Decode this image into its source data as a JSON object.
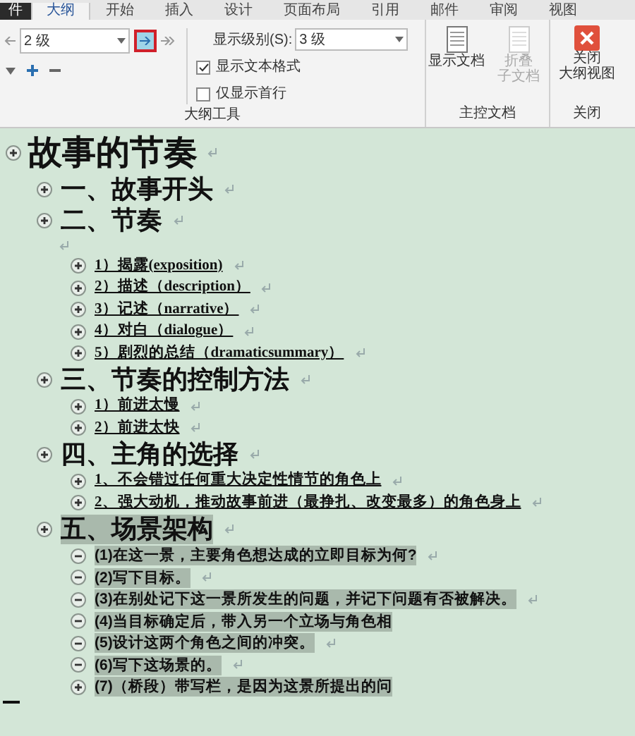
{
  "tabs": [
    {
      "label": "件",
      "selected": false
    },
    {
      "label": "大纲",
      "selected": true
    },
    {
      "label": "开始",
      "selected": false
    },
    {
      "label": "插入",
      "selected": false
    },
    {
      "label": "设计",
      "selected": false
    },
    {
      "label": "页面布局",
      "selected": false
    },
    {
      "label": "引用",
      "selected": false
    },
    {
      "label": "邮件",
      "selected": false
    },
    {
      "label": "审阅",
      "selected": false
    },
    {
      "label": "视图",
      "selected": false
    }
  ],
  "outline_tools": {
    "level_value": "2 级",
    "show_level_label": "显示级别(S):",
    "show_level_value": "3 级",
    "checkboxes": [
      {
        "label": "显示文本格式",
        "checked": true
      },
      {
        "label": "仅显示首行",
        "checked": false
      }
    ],
    "group_label": "大纲工具"
  },
  "master_document": {
    "buttons": [
      {
        "label": "显示文档",
        "disabled": false
      },
      {
        "label": "折叠",
        "label_line_2": "子文档",
        "disabled": true
      }
    ],
    "group_label": "主控文档"
  },
  "close": {
    "button": "关闭",
    "button_line_2": "大纲视图",
    "group_label": "关闭"
  },
  "outline": [
    {
      "text": "故事的节奏",
      "has_subitems": true,
      "underlined": false,
      "selected": false,
      "show_mark": true,
      "children": [
        {
          "text": "一、故事开头",
          "has_subitems": true,
          "underlined": false,
          "selected": false,
          "show_mark": true
        },
        {
          "text": "二、节奏",
          "has_subitems": true,
          "underlined": false,
          "selected": false,
          "show_mark": true,
          "blank_after": true,
          "children": [
            {
              "text": "1）揭露(exposition)",
              "has_subitems": true,
              "underlined": true,
              "selected": false,
              "show_mark": true
            },
            {
              "text": "2）描述（description）",
              "has_subitems": true,
              "underlined": true,
              "selected": false,
              "show_mark": true
            },
            {
              "text": "3）记述（narrative）",
              "has_subitems": true,
              "underlined": true,
              "selected": false,
              "show_mark": true
            },
            {
              "text": "4）对白（dialogue）",
              "has_subitems": true,
              "underlined": true,
              "selected": false,
              "show_mark": true
            },
            {
              "text": "5）剧烈的总结（dramaticsummary）",
              "has_subitems": true,
              "underlined": true,
              "selected": false,
              "show_mark": true
            }
          ]
        },
        {
          "text": "三、节奏的控制方法",
          "has_subitems": true,
          "underlined": false,
          "selected": false,
          "show_mark": true,
          "children": [
            {
              "text": "1）前进太慢",
              "has_subitems": true,
              "underlined": true,
              "selected": false,
              "show_mark": true
            },
            {
              "text": "2）前进太快",
              "has_subitems": true,
              "underlined": true,
              "selected": false,
              "show_mark": true
            }
          ]
        },
        {
          "text": "四、主角的选择",
          "has_subitems": true,
          "underlined": false,
          "selected": false,
          "show_mark": true,
          "children": [
            {
              "text": "1、不会错过任何重大决定性情节的角色上",
              "has_subitems": true,
              "underlined": true,
              "selected": false,
              "show_mark": true
            },
            {
              "text": "2、强大动机，推动故事前进（最挣扎、改变最多）的角色身上",
              "has_subitems": true,
              "underlined": true,
              "selected": false,
              "show_mark": true
            }
          ]
        },
        {
          "text": "五、场景架构",
          "has_subitems": true,
          "underlined": false,
          "selected": true,
          "show_mark": true,
          "children": [
            {
              "text": "(1)在这一景，主要角色想达成的立即目标为何?",
              "has_subitems": false,
              "underlined": false,
              "selected": true,
              "show_mark": true
            },
            {
              "text": "(2)写下目标。",
              "has_subitems": false,
              "underlined": false,
              "selected": true,
              "show_mark": true
            },
            {
              "text": "(3)在别处记下这一景所发生的问题，并记下问题有否被解决。",
              "has_subitems": false,
              "underlined": false,
              "selected": true,
              "show_mark": true
            },
            {
              "text": "(4)当目标确定后，带入另一个立场与角色相",
              "has_subitems": false,
              "underlined": false,
              "selected": true,
              "show_mark": false
            },
            {
              "text": "(5)设计这两个角色之间的冲突。",
              "has_subitems": false,
              "underlined": false,
              "selected": true,
              "show_mark": true
            },
            {
              "text": "(6)写下这场景的。",
              "has_subitems": false,
              "underlined": false,
              "selected": true,
              "show_mark": true
            },
            {
              "text": "(7)（桥段）带写栏，是因为这景所提出的问",
              "has_subitems": true,
              "underlined": false,
              "selected": true,
              "show_mark": false
            }
          ]
        }
      ]
    }
  ]
}
